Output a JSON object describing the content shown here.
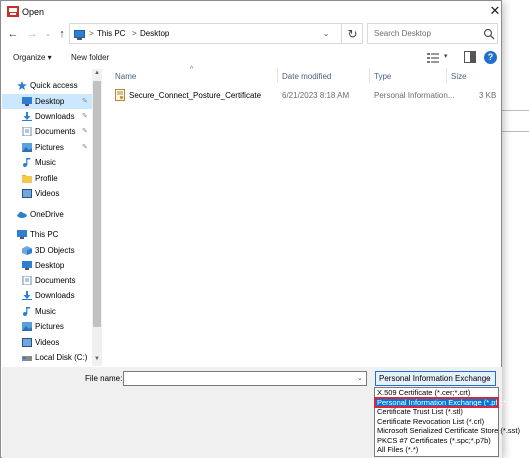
{
  "dialog": {
    "title": "Open",
    "close_glyph": "✕"
  },
  "nav": {
    "back_glyph": "←",
    "forward_glyph": "→",
    "recent_glyph": "⌄",
    "up_glyph": "↑",
    "refresh_glyph": "↻"
  },
  "address": {
    "sep": ">",
    "crumbs": [
      "This PC",
      "Desktop"
    ],
    "dropdown_glyph": "⌄"
  },
  "search": {
    "placeholder": "Search Desktop"
  },
  "toolbar": {
    "organize_label": "Organize ▾",
    "newfolder_label": "New folder",
    "view_dropdown_glyph": "▾",
    "help_glyph": "?"
  },
  "sidebar": {
    "items": [
      {
        "label": "Quick access",
        "icon": "star-icon"
      },
      {
        "label": "Desktop",
        "icon": "desktop-folder-icon",
        "pinned": true,
        "selected": true
      },
      {
        "label": "Downloads",
        "icon": "downloads-icon",
        "pinned": true
      },
      {
        "label": "Documents",
        "icon": "documents-icon",
        "pinned": true
      },
      {
        "label": "Pictures",
        "icon": "pictures-icon",
        "pinned": true
      },
      {
        "label": "Music",
        "icon": "music-icon"
      },
      {
        "label": "Profile",
        "icon": "folder-icon"
      },
      {
        "label": "Videos",
        "icon": "videos-icon"
      },
      {
        "label": "OneDrive",
        "icon": "onedrive-icon"
      },
      {
        "label": "This PC",
        "icon": "this-pc-icon"
      },
      {
        "label": "3D Objects",
        "icon": "3d-objects-icon"
      },
      {
        "label": "Desktop",
        "icon": "desktop-folder-icon"
      },
      {
        "label": "Documents",
        "icon": "documents-icon"
      },
      {
        "label": "Downloads",
        "icon": "downloads-icon"
      },
      {
        "label": "Music",
        "icon": "music-icon"
      },
      {
        "label": "Pictures",
        "icon": "pictures-icon"
      },
      {
        "label": "Videos",
        "icon": "videos-icon"
      },
      {
        "label": "Local Disk (C:)",
        "icon": "disk-icon"
      }
    ],
    "pin_glyph": "✎",
    "scroll_up_glyph": "▲",
    "scroll_down_glyph": "▼"
  },
  "filelist": {
    "sort_glyph": "^",
    "columns": [
      "Name",
      "Date modified",
      "Type",
      "Size"
    ],
    "rows": [
      {
        "name": "Secure_Connect_Posture_Certificate",
        "date": "6/21/2023 8:18 AM",
        "type": "Personal Information...",
        "size": "3 KB"
      }
    ]
  },
  "footer": {
    "filename_label": "File name:",
    "filename_value": "",
    "filename_drop_glyph": "⌄",
    "filetype_selected": "Personal Information Exchange",
    "filetype_arrow": "⌄",
    "filetype_options": [
      "X.509 Certificate (*.cer;*.crt)",
      "Personal Information Exchange (*.pfx;*.p12)",
      "Certificate Trust List (*.stl)",
      "Certificate Revocation List (*.crl)",
      "Microsoft Serialized Certificate Store (*.sst)",
      "PKCS #7 Certificates (*.spc;*.p7b)",
      "All Files (*.*)"
    ]
  },
  "colors": {
    "accent": "#0078d7",
    "selection_bg": "#cce8ff",
    "highlight_outline": "#d7263d"
  }
}
